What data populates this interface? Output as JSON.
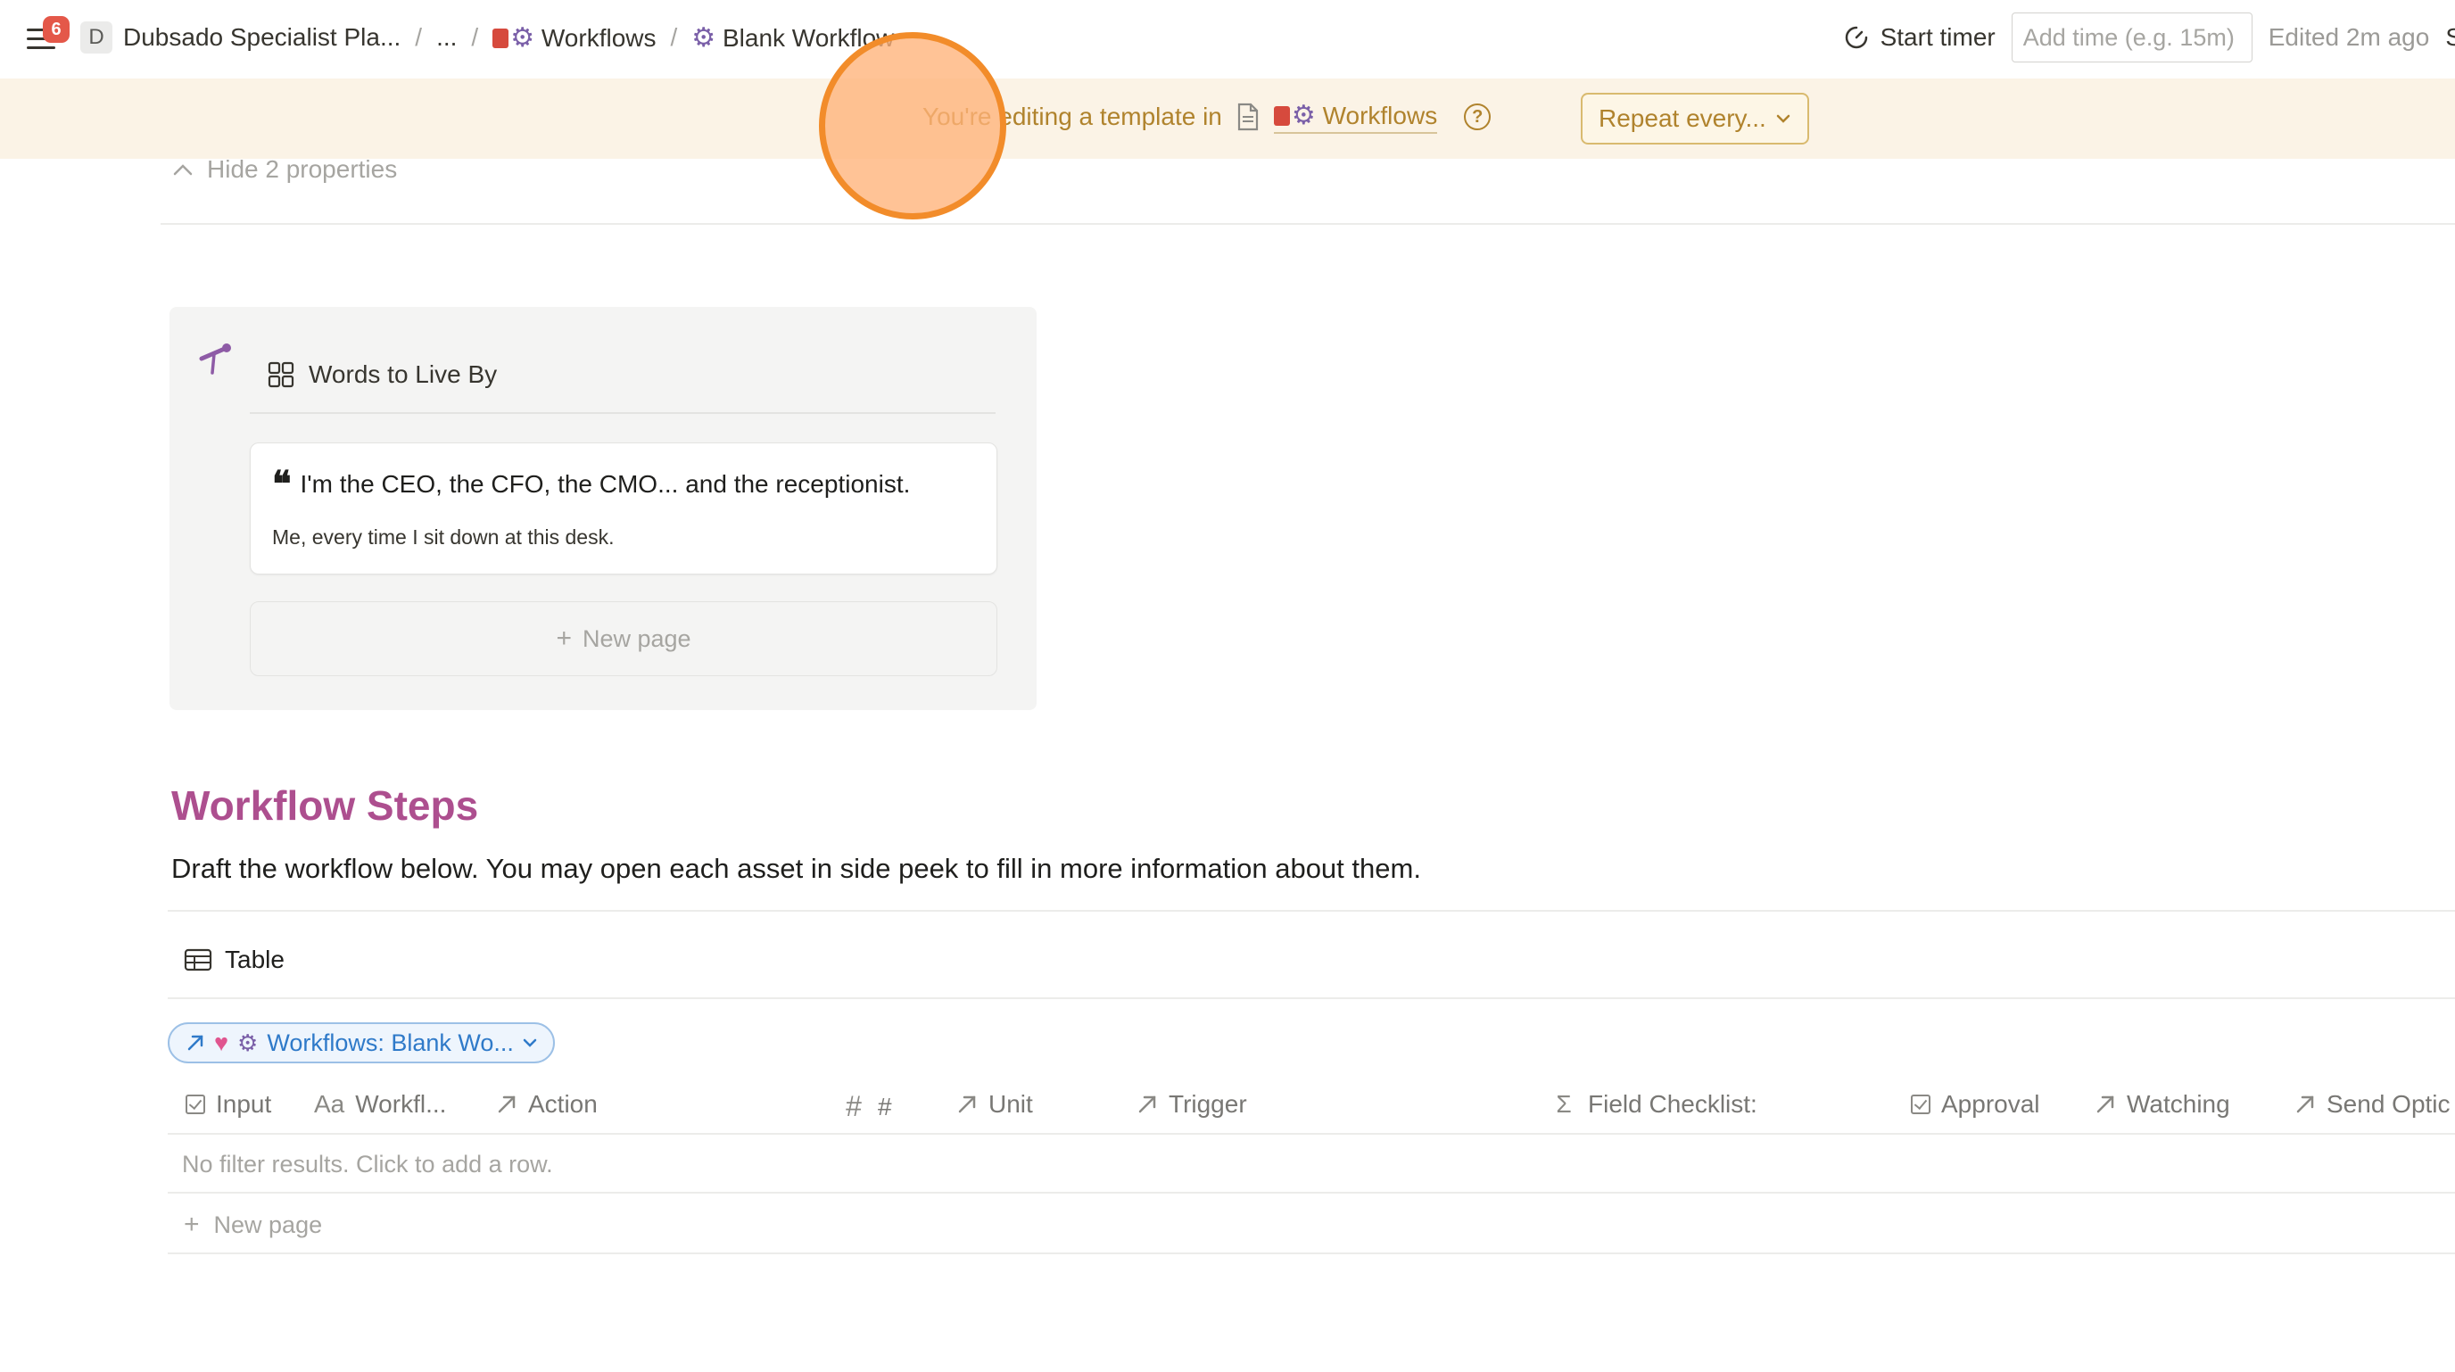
{
  "topbar": {
    "notification_count": "6",
    "workspace_initial": "D",
    "breadcrumbs": [
      "Dubsado Specialist Pla...",
      "...",
      "Workflows",
      "Blank Workflow"
    ],
    "start_timer_label": "Start timer",
    "time_placeholder": "Add time (e.g. 15m)",
    "edited_label": "Edited 2m ago",
    "share_partial": "S"
  },
  "banner": {
    "text": "You're editing a template in",
    "link": "Workflows",
    "help": "?",
    "repeat_label": "Repeat every..."
  },
  "properties": {
    "toggle_label": "Hide 2 properties"
  },
  "callout": {
    "title": "Words to Live By",
    "quote_title": "I'm the CEO, the CFO, the CMO... and the receptionist.",
    "quote_sub": "Me, every time I sit down at this desk.",
    "new_page_label": "New page"
  },
  "steps": {
    "title": "Workflow Steps",
    "description": "Draft the workflow below. You may open each asset in side peek to fill in more information about them.",
    "view_label": "Table",
    "filter_label": "Workflows: Blank Wo...",
    "columns": [
      "Input",
      "Workfl...",
      "Action",
      "#",
      "Unit",
      "Trigger",
      "Field Checklist:",
      "Approval",
      "Watching",
      "Send Optic"
    ],
    "empty_text": "No filter results. Click to add a row.",
    "new_page_label": "New page"
  },
  "colors": {
    "banner_bg": "#fbf3e6",
    "banner_text": "#b0832d",
    "steps_title": "#ad4f8f",
    "filter_chip": "#2f7ac9",
    "click_indicator": "#f28c2a"
  },
  "icons": {
    "menu": "hamburger-icon",
    "timer": "timer-icon",
    "document": "document-icon",
    "help": "help-circle-icon",
    "callout": "telescope-icon",
    "gallery": "gallery-icon",
    "quote": "quote-icon",
    "table": "table-icon"
  }
}
